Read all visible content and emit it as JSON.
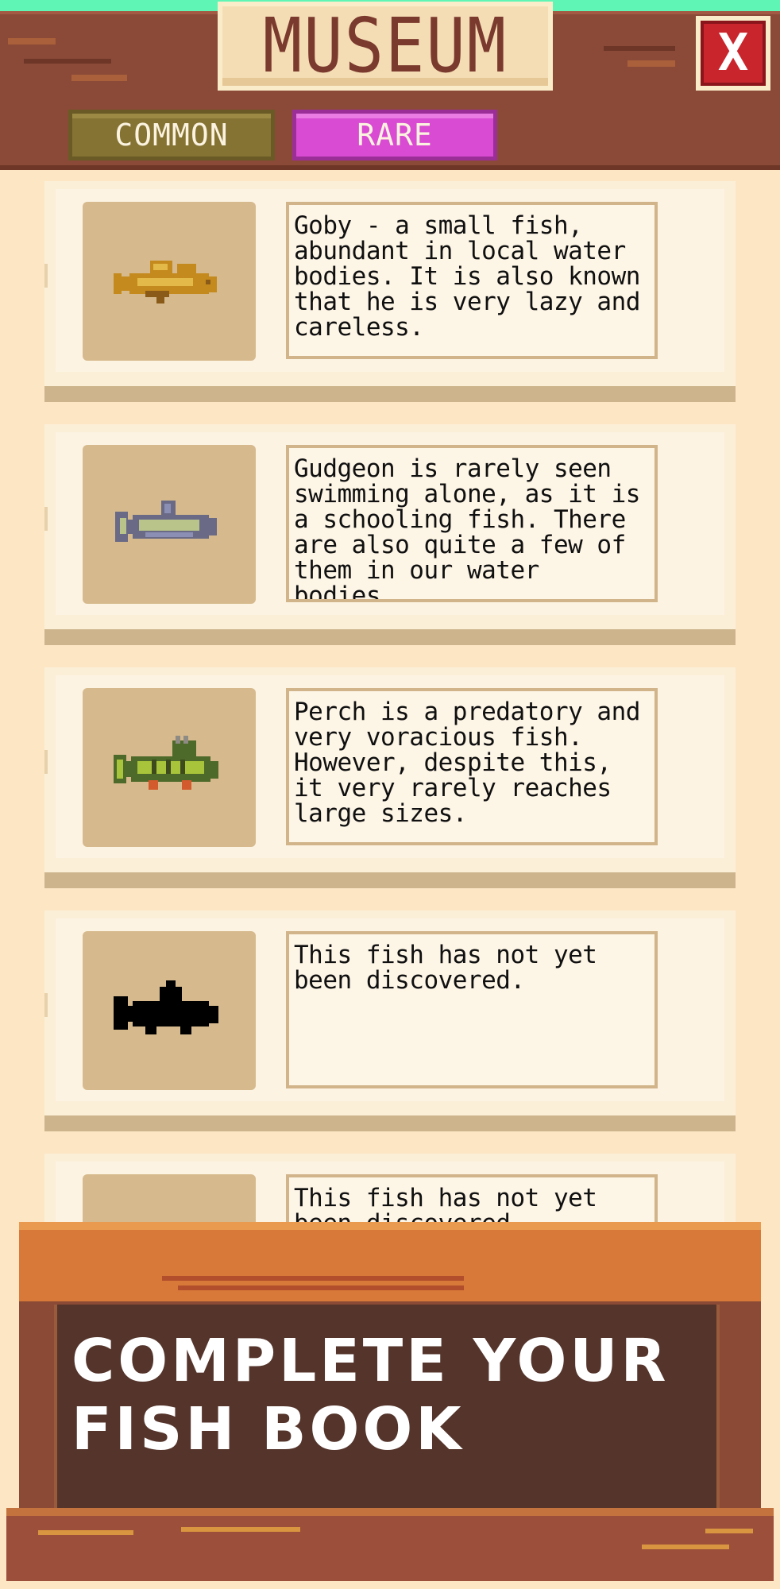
{
  "header": {
    "title": "MUSEUM",
    "close_label": "X"
  },
  "tabs": [
    {
      "label": "COMMON",
      "active": false,
      "color": "#857334"
    },
    {
      "label": "RARE",
      "active": true,
      "color": "#d84bd2"
    }
  ],
  "fish": [
    {
      "icon": "goby-fish-icon",
      "description": "Goby - a small fish, abundant in local water bodies. It is also known that he is very lazy and careless."
    },
    {
      "icon": "gudgeon-fish-icon",
      "description": "Gudgeon is rarely seen swimming alone, as it is a schooling fish. There are also quite a few of them in our water bodies."
    },
    {
      "icon": "perch-fish-icon",
      "description": "Perch is a predatory and very voracious fish. However, despite this, it very rarely reaches large sizes."
    },
    {
      "icon": "unknown-fish-silhouette-icon",
      "description": "This fish has not yet been discovered."
    },
    {
      "icon": "unknown-fish-silhouette-icon",
      "description": "This fish has not yet been discovered."
    }
  ],
  "banner": {
    "line1": "COMPLETE YOUR",
    "line2": "FISH BOOK"
  }
}
